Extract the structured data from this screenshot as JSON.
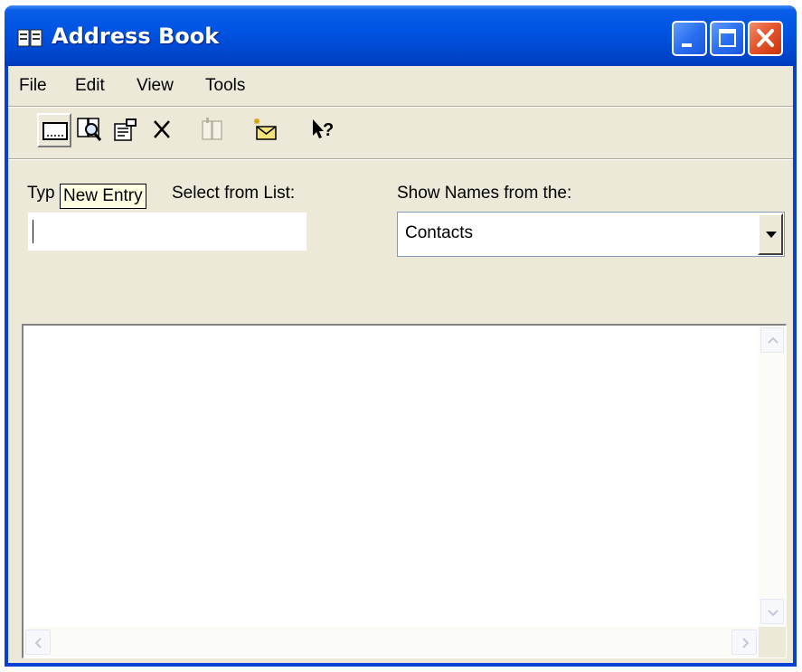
{
  "window": {
    "title": "Address Book"
  },
  "menu": {
    "items": [
      "File",
      "Edit",
      "View",
      "Tools"
    ]
  },
  "toolbar": {
    "buttons": [
      {
        "icon": "new-entry-icon"
      },
      {
        "icon": "find-people-icon"
      },
      {
        "icon": "properties-icon"
      },
      {
        "icon": "delete-icon"
      },
      {
        "icon": "add-to-address-book-icon"
      },
      {
        "icon": "new-message-icon"
      },
      {
        "icon": "whats-this-help-icon"
      }
    ],
    "tooltip": "New Entry"
  },
  "form": {
    "name_label": "Typ",
    "name_label_tail": "Select from List:",
    "name_value": "",
    "show_names_label": "Show Names from the:",
    "show_names_selected": "Contacts"
  },
  "colors": {
    "title_bar": "#0054e3",
    "client_bg": "#ece9d8",
    "tooltip_bg": "#ffffe1",
    "close_button": "#e3522a"
  }
}
